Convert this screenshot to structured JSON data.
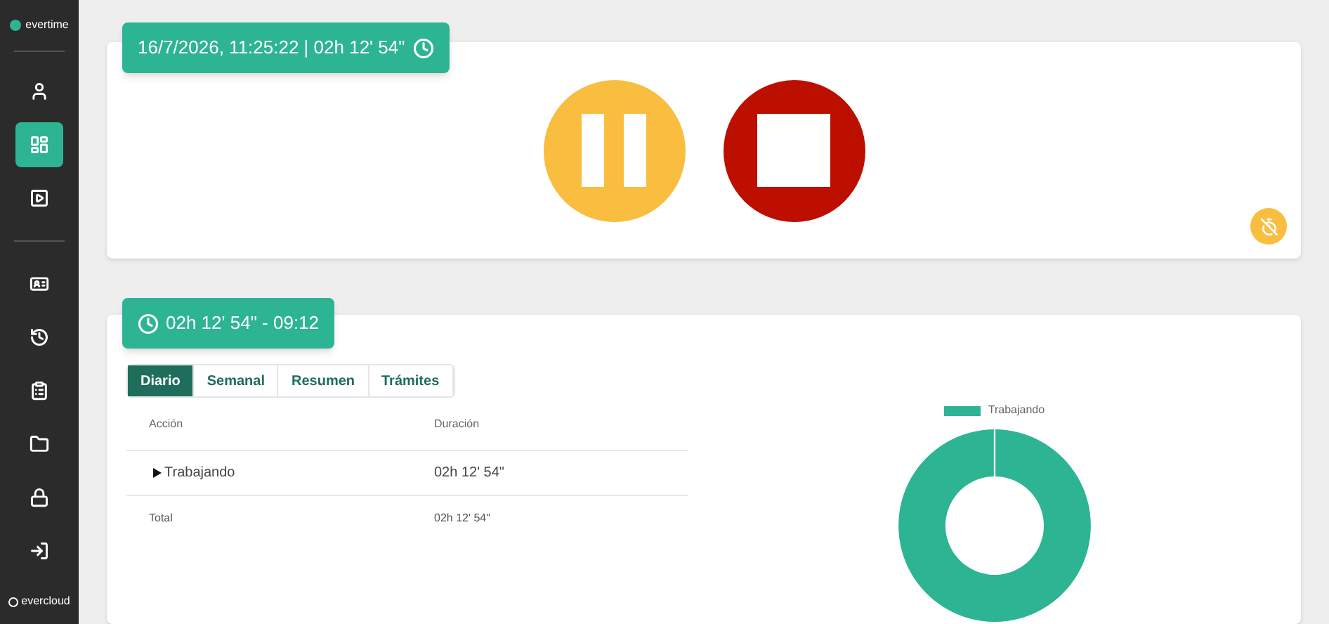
{
  "sidebar": {
    "logo": "evertime",
    "item_groups": [
      [
        {
          "selected": false
        },
        {
          "selected": true
        },
        {
          "selected": false
        }
      ],
      [
        {
          "selected": false
        },
        {
          "selected": false
        },
        {
          "selected": false
        },
        {
          "selected": false
        },
        {
          "selected": false
        },
        {
          "selected": false
        }
      ]
    ],
    "footer": "evercloud"
  },
  "clock_card": {
    "badge": "16/7/2026, 11:25:22 | 02h 12' 54\""
  },
  "summary_card": {
    "badge": "02h 12' 54\" - 09:12",
    "tabs": [
      {
        "label": "Diario",
        "selected": true
      },
      {
        "label": "Semanal",
        "selected": false
      },
      {
        "label": "Resumen",
        "selected": false
      },
      {
        "label": "Trámites",
        "selected": false
      }
    ],
    "table": {
      "columns": [
        "Acción",
        "Duración"
      ],
      "rows": [
        {
          "action": "Trabajando",
          "duration": "02h 12' 54\""
        }
      ],
      "total": {
        "label": "Total",
        "duration": "02h 12' 54\""
      }
    },
    "legend": {
      "label": "Trabajando",
      "color": "#2db493"
    }
  }
}
